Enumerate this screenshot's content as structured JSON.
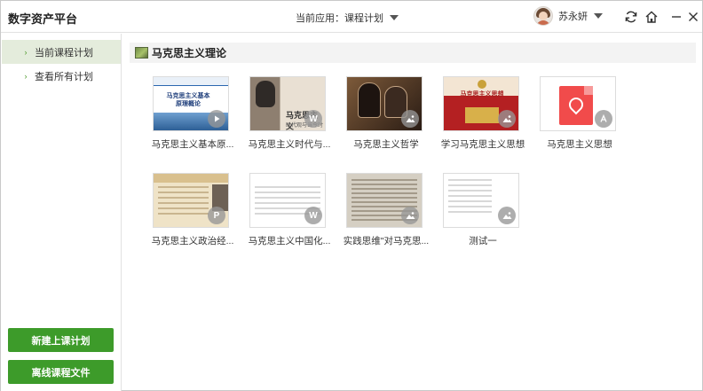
{
  "app": {
    "title": "数字资产平台",
    "current_app_label": "当前应用：课程计划",
    "user_name": "苏永妍"
  },
  "sidebar": {
    "items": [
      {
        "label": "当前课程计划",
        "active": true
      },
      {
        "label": "查看所有计划",
        "active": false
      }
    ],
    "buttons": {
      "new_plan": "新建上课计划",
      "offline_files": "离线课程文件"
    }
  },
  "main": {
    "section_title": "马克思主义理论",
    "files": [
      {
        "label": "马克思主义基本原...",
        "type": "video",
        "thumb_text": [
          "马克思主义基本",
          "原理概论"
        ]
      },
      {
        "label": "马克思主义时代与...",
        "type": "word",
        "thumb_text": [
          "马克思主义",
          "时代观与当今时代"
        ]
      },
      {
        "label": "马克思主义哲学",
        "type": "image"
      },
      {
        "label": "学习马克思主义思想",
        "type": "image",
        "thumb_text": [
          "马克思主义思想"
        ]
      },
      {
        "label": "马克思主义思想",
        "type": "pdf"
      },
      {
        "label": "马克思主义政治经...",
        "type": "ppt"
      },
      {
        "label": "马克思主义中国化...",
        "type": "word"
      },
      {
        "label": "实践思维\"对马克思...",
        "type": "image"
      },
      {
        "label": "测试一",
        "type": "image"
      }
    ]
  },
  "colors": {
    "accent_green": "#3d9b2a",
    "active_bg": "#e4ecdc",
    "pdf_red": "#f14b4b"
  },
  "icons": {
    "refresh": "refresh-icon",
    "home": "home-icon",
    "minimize": "minimize-icon",
    "close": "close-icon"
  }
}
